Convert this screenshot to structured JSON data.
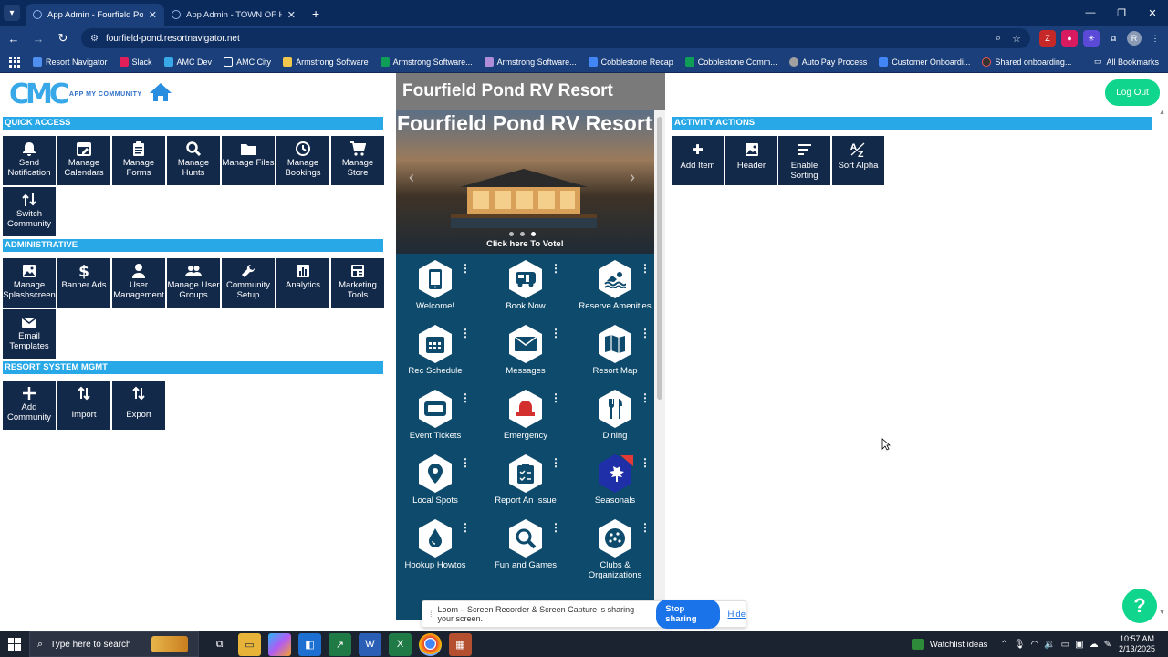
{
  "browser": {
    "tabs": [
      {
        "title": "App Admin - Fourfield Pond RV Resort",
        "active": true
      },
      {
        "title": "App Admin - TOWN OF HAMDEN",
        "active": false
      }
    ],
    "url": "fourfield-pond.resortnavigator.net",
    "bookmarks": [
      {
        "label": "Resort Navigator",
        "color": "#4f8ff0"
      },
      {
        "label": "Slack",
        "color": "#e01e5a"
      },
      {
        "label": "AMC Dev",
        "color": "#38a8e8"
      },
      {
        "label": "AMC City",
        "color": "#f2c94c"
      },
      {
        "label": "Armstrong Software",
        "color": "#f2c94c"
      },
      {
        "label": "Armstrong Software...",
        "color": "#0f9d58"
      },
      {
        "label": "Armstrong Software...",
        "color": "#b08dd8"
      },
      {
        "label": "Cobblestone Recap",
        "color": "#4285f4"
      },
      {
        "label": "Cobblestone Comm...",
        "color": "#0f9d58"
      },
      {
        "label": "Auto Pay Process",
        "color": "#a0a0a0"
      },
      {
        "label": "Customer Onboardi...",
        "color": "#4285f4"
      },
      {
        "label": "Shared onboarding...",
        "color": "#333333"
      }
    ],
    "all_bookmarks": "All Bookmarks"
  },
  "header": {
    "logo_text": "APP MY COMMUNITY",
    "logout": "Log Out"
  },
  "quick_access": {
    "title": "QUICK ACCESS",
    "tiles": [
      {
        "label": "Send Notification",
        "icon": "bell-icon"
      },
      {
        "label": "Manage Calendars",
        "icon": "calendar-edit-icon"
      },
      {
        "label": "Manage Forms",
        "icon": "clipboard-icon"
      },
      {
        "label": "Manage Hunts",
        "icon": "search-icon"
      },
      {
        "label": "Manage Files",
        "icon": "folder-icon"
      },
      {
        "label": "Manage Bookings",
        "icon": "clock-icon"
      },
      {
        "label": "Manage Store",
        "icon": "cart-icon"
      },
      {
        "label": "Switch Community",
        "icon": "switch-icon"
      }
    ]
  },
  "administrative": {
    "title": "ADMINISTRATIVE",
    "tiles": [
      {
        "label": "Manage Splashscreen",
        "icon": "image-icon"
      },
      {
        "label": "Banner Ads",
        "icon": "dollar-icon"
      },
      {
        "label": "User Management",
        "icon": "user-icon"
      },
      {
        "label": "Manage User Groups",
        "icon": "users-icon"
      },
      {
        "label": "Community Setup",
        "icon": "wrench-icon"
      },
      {
        "label": "Analytics",
        "icon": "chart-icon"
      },
      {
        "label": "Marketing Tools",
        "icon": "newspaper-icon"
      },
      {
        "label": "Email Templates",
        "icon": "envelope-icon"
      }
    ]
  },
  "resort_system": {
    "title": "RESORT SYSTEM MGMT",
    "tiles": [
      {
        "label": "Add Community",
        "icon": "plus-icon"
      },
      {
        "label": "Import",
        "icon": "sort-arrows-icon"
      },
      {
        "label": "Export",
        "icon": "sort-arrows-icon"
      }
    ]
  },
  "phone": {
    "header": "Fourfield Pond RV Resort",
    "banner_title": "Fourfield Pond RV Resort",
    "vote_text": "Click here To Vote!",
    "apps": [
      {
        "label": "Welcome!",
        "icon": "phone-icon"
      },
      {
        "label": "Book Now",
        "icon": "rv-icon"
      },
      {
        "label": "Reserve Amenities",
        "icon": "swimmer-icon"
      },
      {
        "label": "Rec Schedule",
        "icon": "calendar-icon"
      },
      {
        "label": "Messages",
        "icon": "envelope-icon"
      },
      {
        "label": "Resort Map",
        "icon": "map-icon"
      },
      {
        "label": "Event Tickets",
        "icon": "ticket-icon"
      },
      {
        "label": "Emergency",
        "icon": "siren-icon"
      },
      {
        "label": "Dining",
        "icon": "utensils-icon"
      },
      {
        "label": "Local Spots",
        "icon": "map-pin-icon"
      },
      {
        "label": "Report An Issue",
        "icon": "clipboard-check-icon"
      },
      {
        "label": "Seasonals",
        "icon": "maple-leaf-icon"
      },
      {
        "label": "Hookup Howtos",
        "icon": "water-drop-icon"
      },
      {
        "label": "Fun and Games",
        "icon": "magnifier-icon"
      },
      {
        "label": "Clubs & Organizations",
        "icon": "ball-icon"
      }
    ]
  },
  "activity_actions": {
    "title": "ACTIVITY ACTIONS",
    "tiles": [
      {
        "label": "Add Item",
        "icon": "plus-icon"
      },
      {
        "label": "Header",
        "icon": "image-icon"
      },
      {
        "label": "Enable Sorting",
        "icon": "sort-lines-icon"
      },
      {
        "label": "Sort Alpha",
        "icon": "sort-az-icon"
      }
    ]
  },
  "loom": {
    "message": "Loom – Screen Recorder & Screen Capture is sharing your screen.",
    "stop": "Stop sharing",
    "hide": "Hide"
  },
  "taskbar": {
    "search_placeholder": "Type here to search",
    "watchlist": "Watchlist ideas",
    "time": "10:57 AM",
    "date": "2/13/2025"
  }
}
